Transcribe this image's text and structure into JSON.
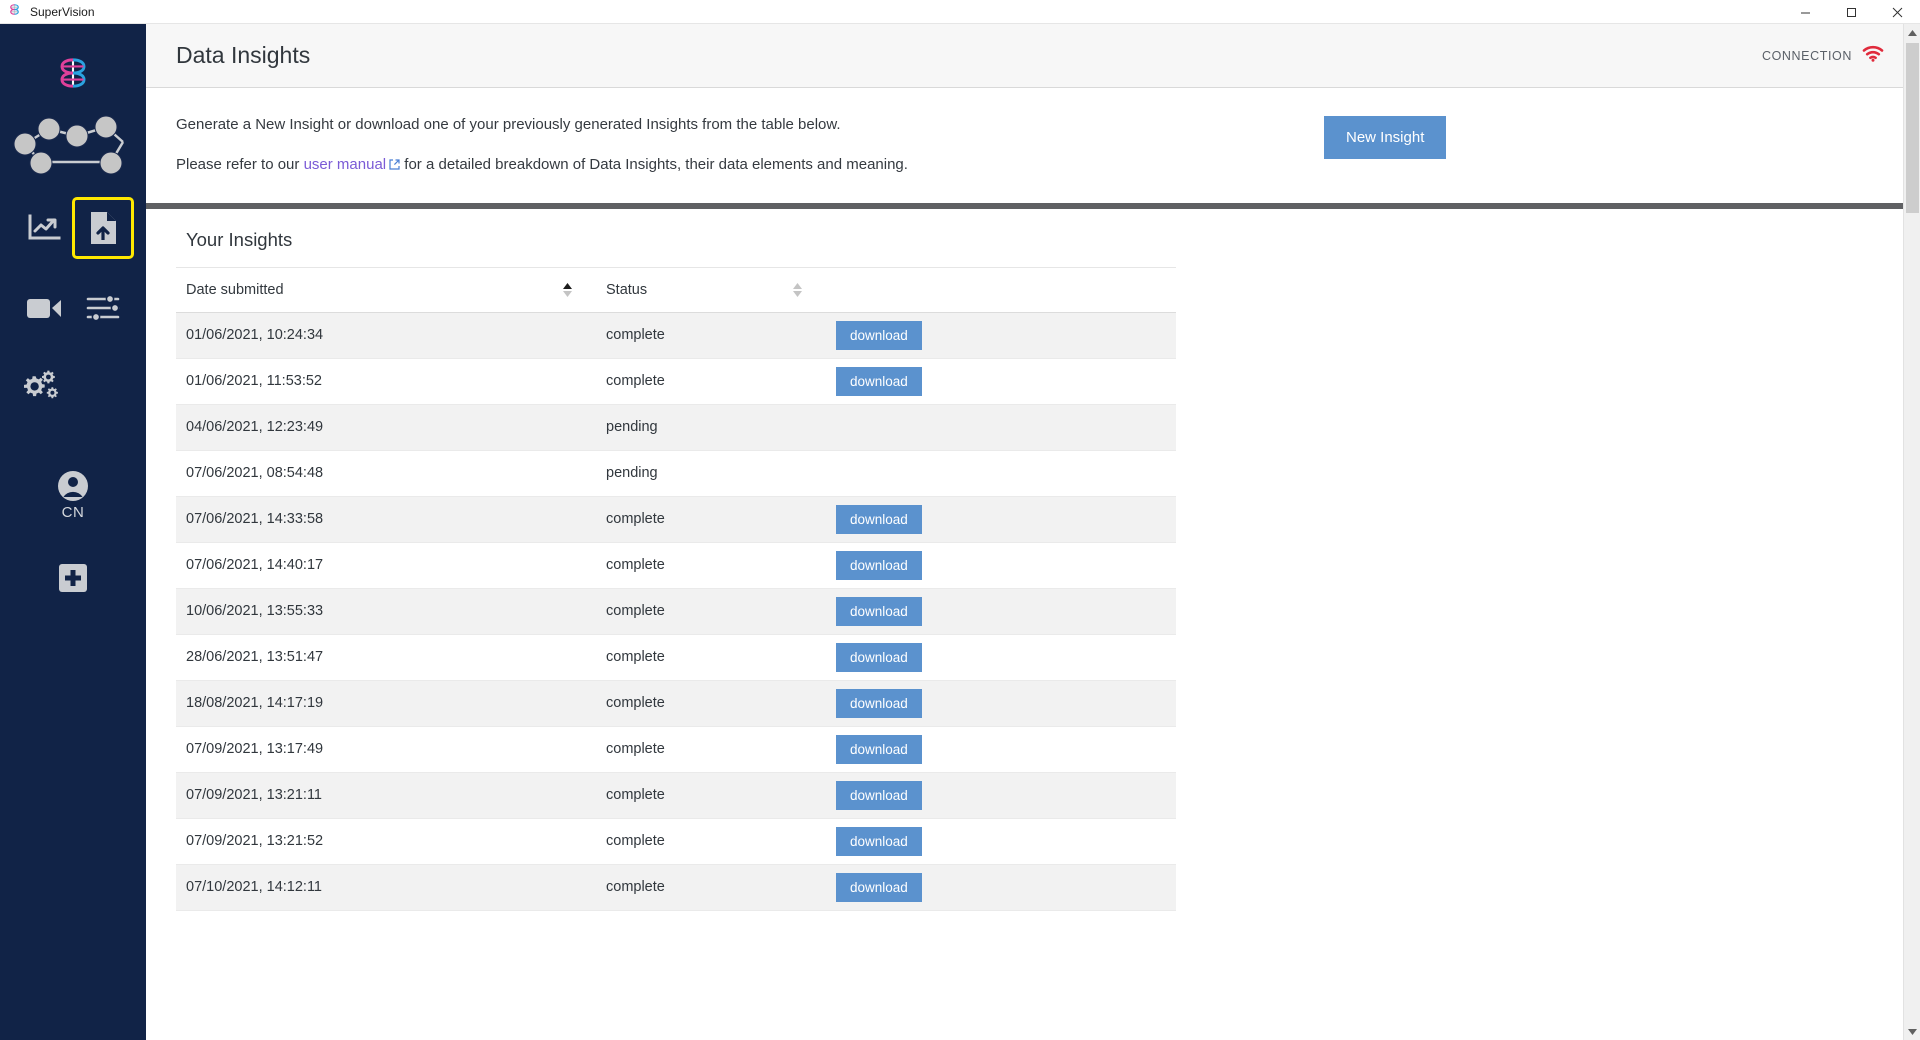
{
  "window": {
    "app_title": "SuperVision",
    "logo_icon": "brain-logo-icon",
    "controls": [
      {
        "name": "minimize",
        "glyph": "─"
      },
      {
        "name": "maximize",
        "glyph": "❐"
      },
      {
        "name": "close",
        "glyph": "✕"
      }
    ]
  },
  "sidebar": {
    "logo_icon": "brain-logo-icon",
    "network_icon": "network-graph-icon",
    "nav_items": [
      {
        "name": "analytics",
        "icon": "line-chart-icon",
        "selected": false
      },
      {
        "name": "data-insights",
        "icon": "document-upload-icon",
        "selected": true
      },
      {
        "name": "video",
        "icon": "video-camera-icon",
        "selected": false
      },
      {
        "name": "settings-sliders",
        "icon": "sliders-icon",
        "selected": false
      }
    ],
    "gears": {
      "name": "configuration",
      "icon": "gears-icon"
    },
    "user": {
      "avatar_icon": "user-avatar-icon",
      "initials": "CN"
    },
    "add": {
      "name": "add",
      "icon": "plus-square-icon"
    }
  },
  "header": {
    "title": "Data Insights",
    "connection_label": "CONNECTION",
    "connection_icon": "wifi-icon",
    "connection_color": "#e02b3c"
  },
  "intro": {
    "line1": "Generate a New Insight or download one of your previously generated Insights from the table below.",
    "line2_before": "Please refer to our ",
    "link_text": "user manual",
    "link_icon": "external-link-icon",
    "line2_after": " for a detailed breakdown of Data Insights, their data elements and meaning.",
    "button_label": "New Insight",
    "button_color": "#5b92ce"
  },
  "table": {
    "section_title": "Your Insights",
    "columns": [
      {
        "label": "Date submitted",
        "sort": "asc"
      },
      {
        "label": "Status",
        "sort": "none"
      },
      {
        "label": ""
      }
    ],
    "action_label": "download",
    "rows": [
      {
        "date": "01/06/2021, 10:24:34",
        "status": "complete",
        "action": "download"
      },
      {
        "date": "01/06/2021, 11:53:52",
        "status": "complete",
        "action": "download"
      },
      {
        "date": "04/06/2021, 12:23:49",
        "status": "pending",
        "action": ""
      },
      {
        "date": "07/06/2021, 08:54:48",
        "status": "pending",
        "action": ""
      },
      {
        "date": "07/06/2021, 14:33:58",
        "status": "complete",
        "action": "download"
      },
      {
        "date": "07/06/2021, 14:40:17",
        "status": "complete",
        "action": "download"
      },
      {
        "date": "10/06/2021, 13:55:33",
        "status": "complete",
        "action": "download"
      },
      {
        "date": "28/06/2021, 13:51:47",
        "status": "complete",
        "action": "download"
      },
      {
        "date": "18/08/2021, 14:17:19",
        "status": "complete",
        "action": "download"
      },
      {
        "date": "07/09/2021, 13:17:49",
        "status": "complete",
        "action": "download"
      },
      {
        "date": "07/09/2021, 13:21:11",
        "status": "complete",
        "action": "download"
      },
      {
        "date": "07/09/2021, 13:21:52",
        "status": "complete",
        "action": "download"
      },
      {
        "date": "07/10/2021, 14:12:11",
        "status": "complete",
        "action": "download"
      }
    ]
  },
  "scrollbar": {
    "name": "vertical-scrollbar"
  }
}
